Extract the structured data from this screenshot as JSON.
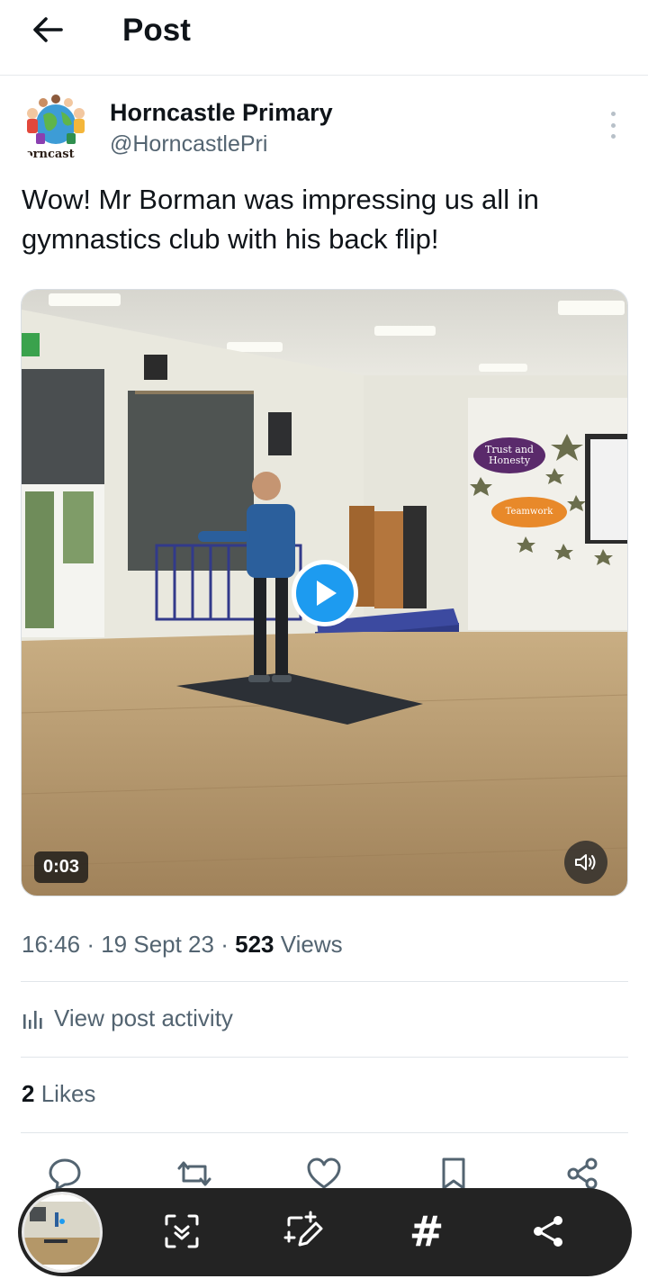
{
  "header": {
    "title": "Post"
  },
  "author": {
    "name": "Horncastle Primary",
    "handle": "@HorncastlePri",
    "avatar_text": "orncast"
  },
  "post": {
    "text": "Wow! Mr Borman was impressing us all in gymnastics club with his back flip!",
    "video": {
      "duration": "0:03",
      "wall_sign_1": "Trust and Honesty",
      "wall_sign_2": "Teamwork"
    },
    "time": "16:46",
    "date": "19 Sept 23",
    "views_count": "523",
    "views_label": "Views",
    "activity_label": "View post activity",
    "likes_count": "2",
    "likes_label": "Likes"
  },
  "actions": [
    "reply-icon",
    "repost-icon",
    "like-icon",
    "bookmark-icon",
    "share-icon"
  ],
  "screenshot_toolbar": {
    "hash_label": "#",
    "tools": [
      "scan-icon",
      "edit-icon",
      "hashtag-icon",
      "share-icon"
    ]
  },
  "colors": {
    "accent": "#1d9bf0",
    "text": "#0f1419",
    "secondary": "#536471",
    "toolbar_bg": "#232323"
  }
}
